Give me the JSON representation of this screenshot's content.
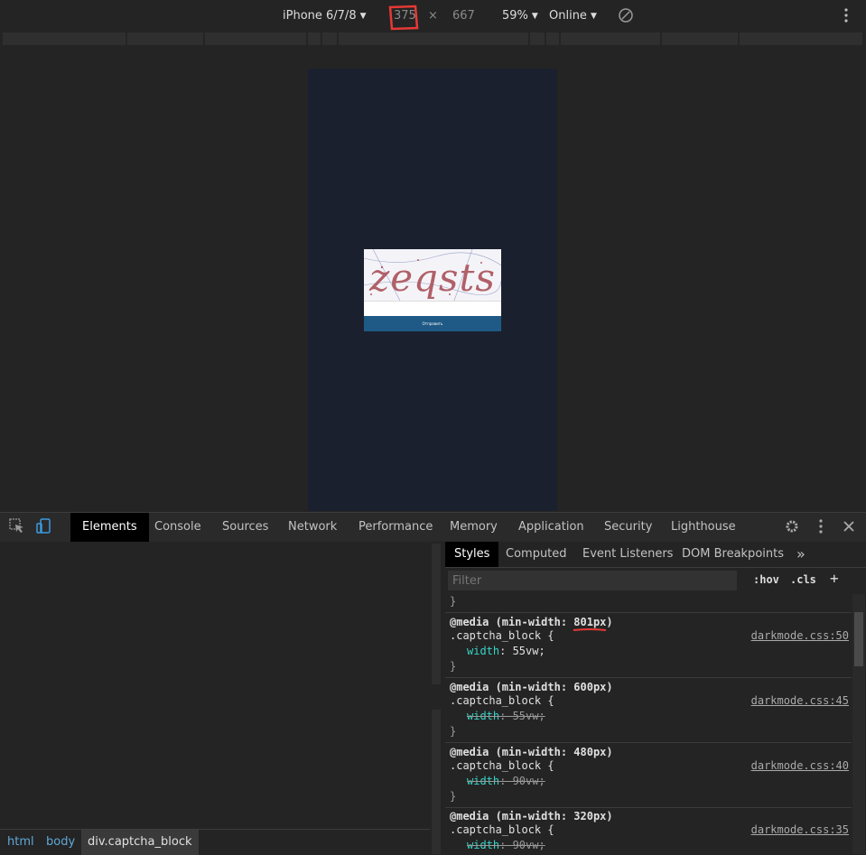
{
  "device_toolbar": {
    "device": "iPhone 6/7/8",
    "width": "375",
    "times": "×",
    "height": "667",
    "zoom": "59%",
    "network": "Online"
  },
  "captcha": {
    "text": "zeqsts",
    "button_label": "Отправить"
  },
  "devtools_tabs": [
    "Elements",
    "Console",
    "Sources",
    "Network",
    "Performance",
    "Memory",
    "Application",
    "Security",
    "Lighthouse"
  ],
  "styles_tabs": [
    "Styles",
    "Computed",
    "Event Listeners",
    "DOM Breakpoints",
    "»"
  ],
  "filter": {
    "placeholder": "Filter",
    "hov": ":hov",
    "cls": ".cls",
    "add": "+"
  },
  "top_brace": "}",
  "rules": [
    {
      "media": "@media (min-width: ",
      "media_value": "801px",
      "media_end": ")",
      "selector": ".captcha_block {",
      "prop": "width",
      "value": "55vw;",
      "struck": false,
      "source": "darkmode.css:50"
    },
    {
      "media": "@media (min-width: ",
      "media_value": "600px",
      "media_end": ")",
      "selector": ".captcha_block {",
      "prop": "width",
      "value": "55vw;",
      "struck": true,
      "source": "darkmode.css:45"
    },
    {
      "media": "@media (min-width: ",
      "media_value": "480px",
      "media_end": ")",
      "selector": ".captcha_block {",
      "prop": "width",
      "value": "90vw;",
      "struck": true,
      "source": "darkmode.css:40"
    },
    {
      "media": "@media (min-width: ",
      "media_value": "320px",
      "media_end": ")",
      "selector": ".captcha_block {",
      "prop": "width",
      "value": "90vw;",
      "struck": true,
      "source": "darkmode.css:35"
    }
  ],
  "breadcrumb": [
    "html",
    "body",
    "div.captcha_block"
  ],
  "colors": {
    "accent_red": "#e53935",
    "property": "#35d4c7",
    "link": "#5fa8d8"
  },
  "icons": [
    "inspect-element-icon",
    "device-toggle-icon",
    "settings-gear-icon",
    "more-vert-icon",
    "close-icon",
    "rotate-icon",
    "more-devtools-icon"
  ]
}
